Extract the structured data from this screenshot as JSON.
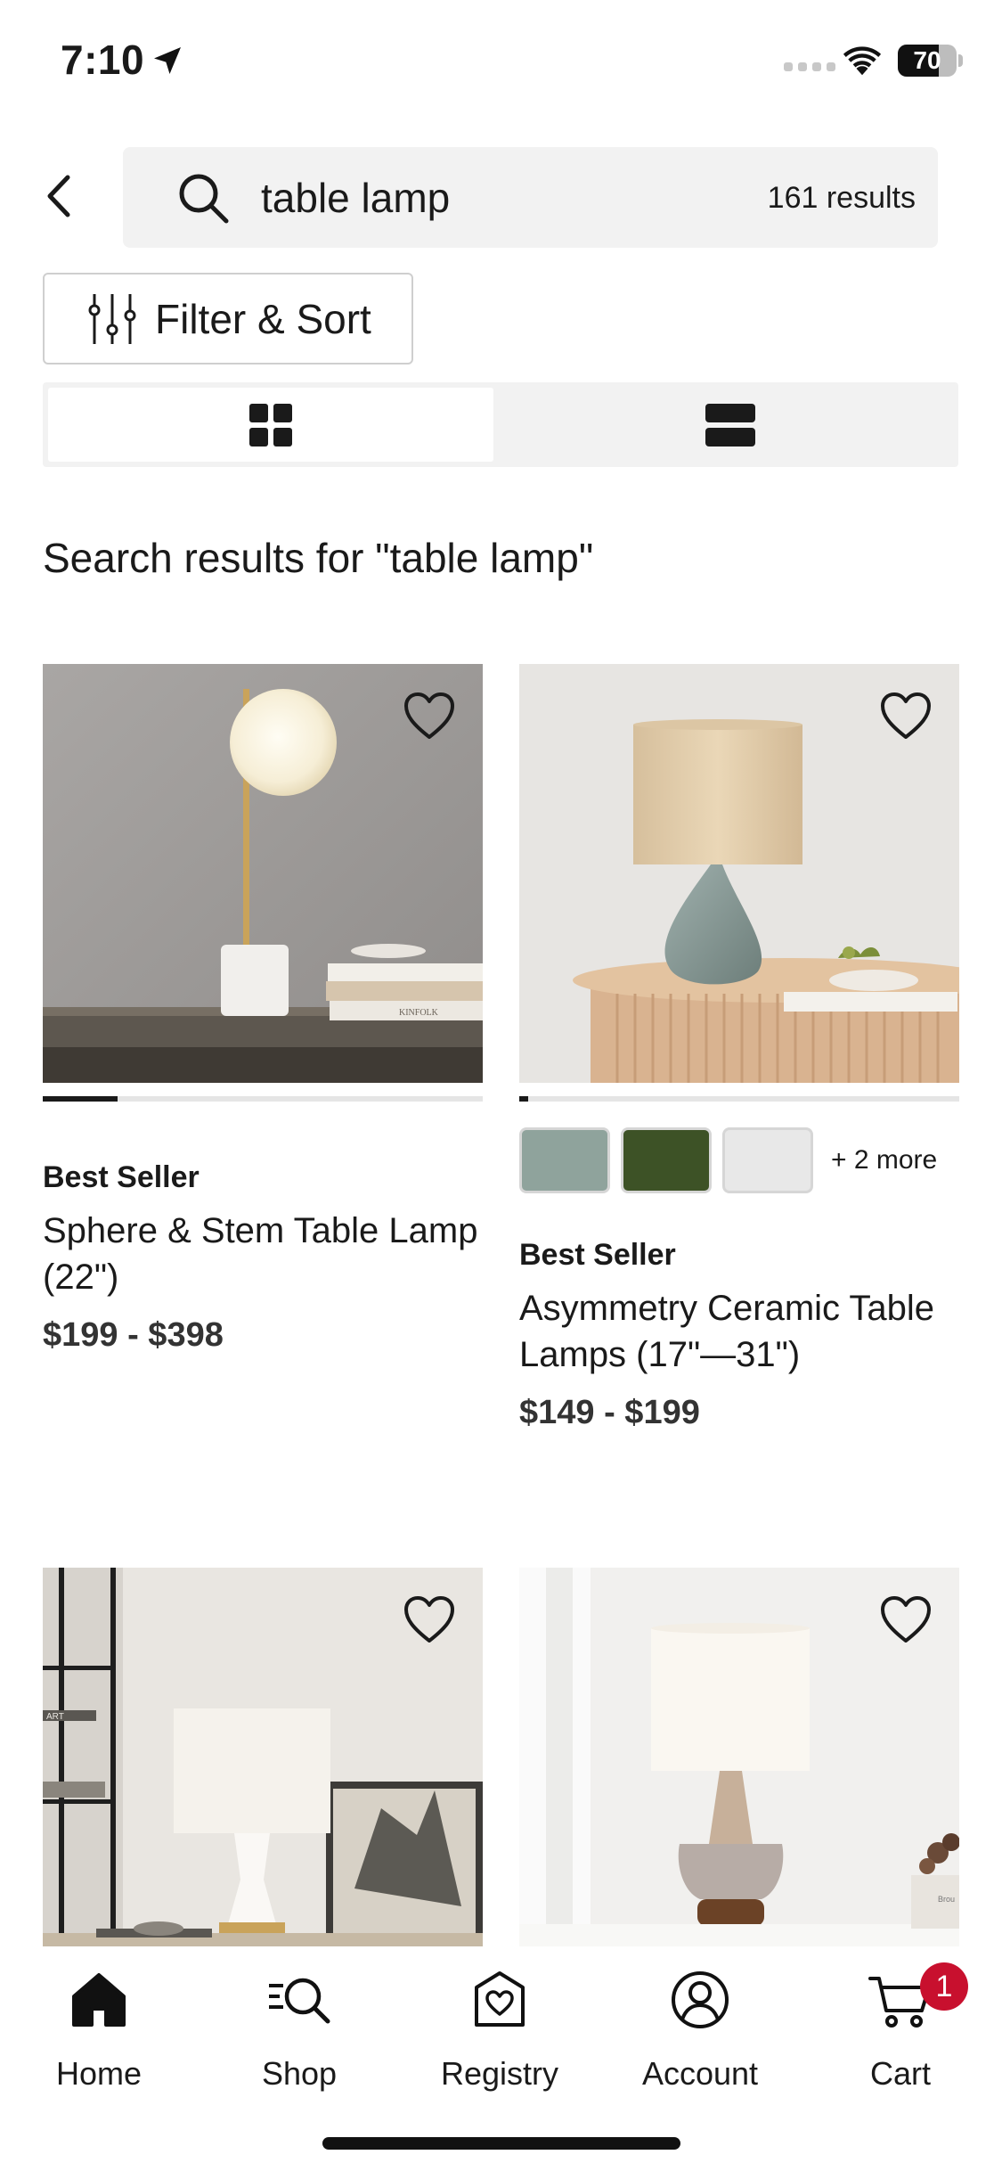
{
  "status_bar": {
    "time": "7:10",
    "battery": "70",
    "battery_level": 0.7
  },
  "search": {
    "query": "table lamp",
    "results_count": "161 results"
  },
  "filter": {
    "label": "Filter & Sort"
  },
  "view_toggle": {
    "selected": "grid"
  },
  "results_heading": "Search results for \"table lamp\"",
  "products": [
    {
      "badge": "Best Seller",
      "name": "Sphere & Stem Table Lamp (22\")",
      "price": "$199 - $398",
      "carousel_progress": 0.17,
      "book_text": "KINFOLK"
    },
    {
      "badge": "Best Seller",
      "name": "Asymmetry Ceramic Table Lamps (17\"—31\")",
      "price": "$149 - $199",
      "carousel_progress": 0.02,
      "swatches": [
        "#8fa39c",
        "#3d5226",
        "#e8e8e8"
      ],
      "swatches_more": "+ 2 more"
    },
    {
      "book_text": "ART"
    },
    {
      "book_text": "Brou"
    }
  ],
  "tab_bar": {
    "tabs": [
      {
        "label": "Home",
        "icon": "home-icon"
      },
      {
        "label": "Shop",
        "icon": "shop-search-icon"
      },
      {
        "label": "Registry",
        "icon": "registry-heart-icon"
      },
      {
        "label": "Account",
        "icon": "account-icon"
      },
      {
        "label": "Cart",
        "icon": "cart-icon"
      }
    ],
    "cart_count": "1",
    "cart_badge_color": "#c8102e"
  }
}
